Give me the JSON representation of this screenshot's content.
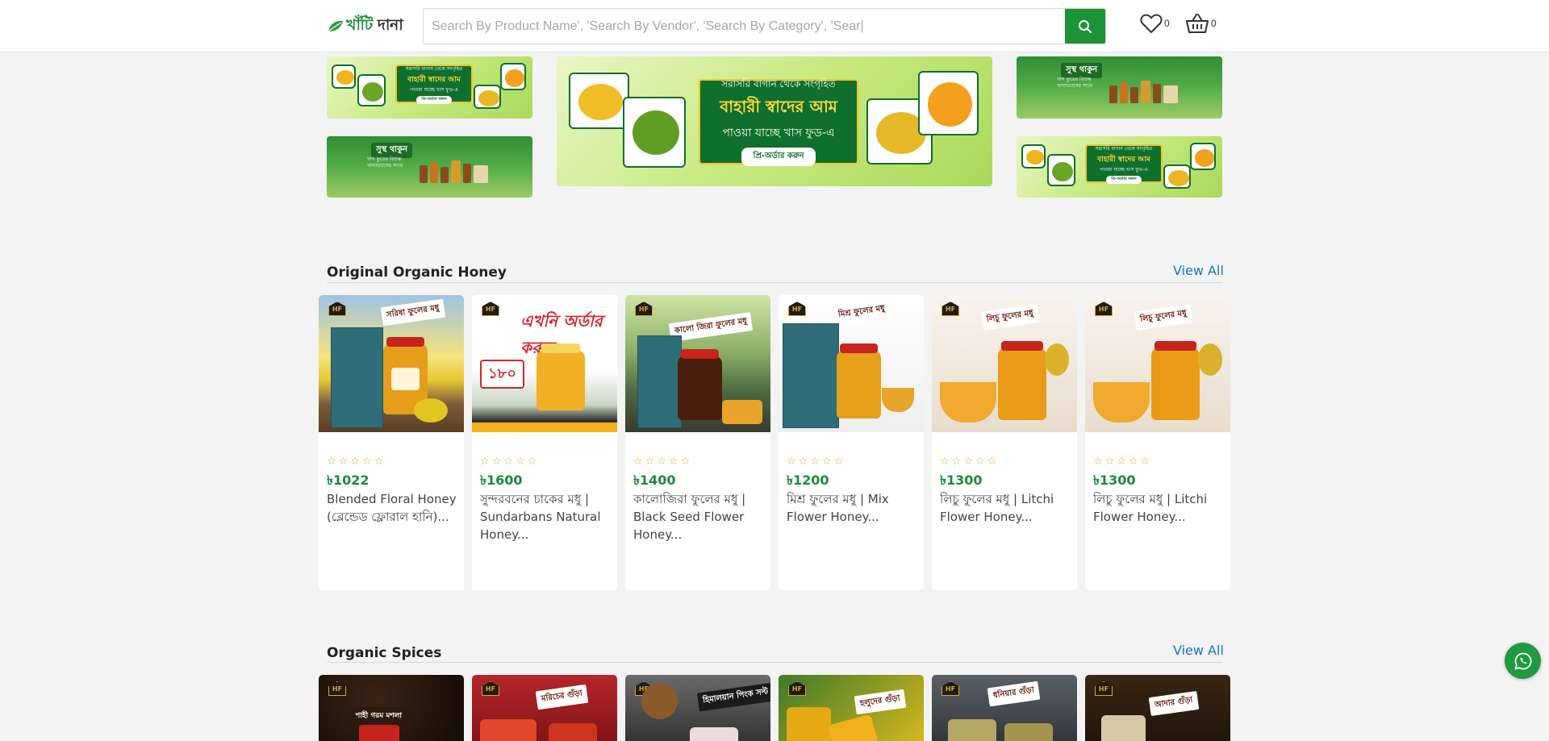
{
  "header": {
    "logo_green": "খাঁটি",
    "logo_dark": " দানা",
    "search_placeholder": "Search By Product Name', 'Search By Vendor', 'Search By Category', 'Sear|",
    "wishlist_count": "0",
    "cart_count": "0"
  },
  "banners": {
    "mango": {
      "line1": "সরাসরি বাগান থেকে সংগৃহিত",
      "line2": "বাহারী স্বাদের আম",
      "line3": "পাওয়া যাচ্ছে খাস ফুড-এ",
      "cta": "প্রি-অর্ডার করুন"
    },
    "healthy": {
      "tag": "সুস্থ থাকুন",
      "sub": "খাস ফুডের বিশুদ্ধ খাদ্যাভ্যাসের সাথে"
    }
  },
  "sections": [
    {
      "title": "Original Organic Honey",
      "view_all": "View All",
      "products": [
        {
          "price": "৳1022",
          "name": "Blended Floral Honey (ব্লেন্ডেড ফ্লোরাল হানি)...",
          "badge": "সরিষা ফুলের মধু",
          "rating": 0
        },
        {
          "price": "৳1600",
          "name": "সুন্দরবনের চাকের মধু | Sundarbans Natural Honey...",
          "badge": "এখনি অর্ডার করুন",
          "rating": 0
        },
        {
          "price": "৳1400",
          "name": "কালোজিরা ফুলের মধু | Black Seed Flower Honey...",
          "badge": "কালো জিরা ফুলের মধু",
          "rating": 0
        },
        {
          "price": "৳1200",
          "name": "মিশ্র ফুলের মধু | Mix Flower Honey...",
          "badge": "মিশ্র ফুলের মধু",
          "rating": 0
        },
        {
          "price": "৳1300",
          "name": "লিচু ফুলের মধু | Litchi Flower Honey...",
          "badge": "লিচু ফুলের মধু",
          "rating": 0
        },
        {
          "price": "৳1300",
          "name": "লিচু ফুলের মধু | Litchi Flower Honey...",
          "badge": "লিচু ফুলের মধু",
          "rating": 0
        }
      ]
    },
    {
      "title": "Organic Spices",
      "view_all": "View All",
      "products": [
        {
          "badge": "শাহী গরম মশলা"
        },
        {
          "badge": "মরিচের গুঁড়া"
        },
        {
          "badge": "হিমালয়ান পিংক সল্ট"
        },
        {
          "badge": "হলুদের গুঁড়া"
        },
        {
          "badge": "ধনিয়ার গুঁড়া"
        },
        {
          "badge": "আদার গুঁড়া"
        }
      ]
    }
  ],
  "colors": {
    "brand_green": "#1d9437",
    "price_green": "#1d8a36",
    "link_blue": "#1576c9",
    "star": "#f5a623"
  },
  "icons": [
    "search-icon",
    "heart-icon",
    "basket-icon",
    "star-outline-icon",
    "whatsapp-icon"
  ]
}
